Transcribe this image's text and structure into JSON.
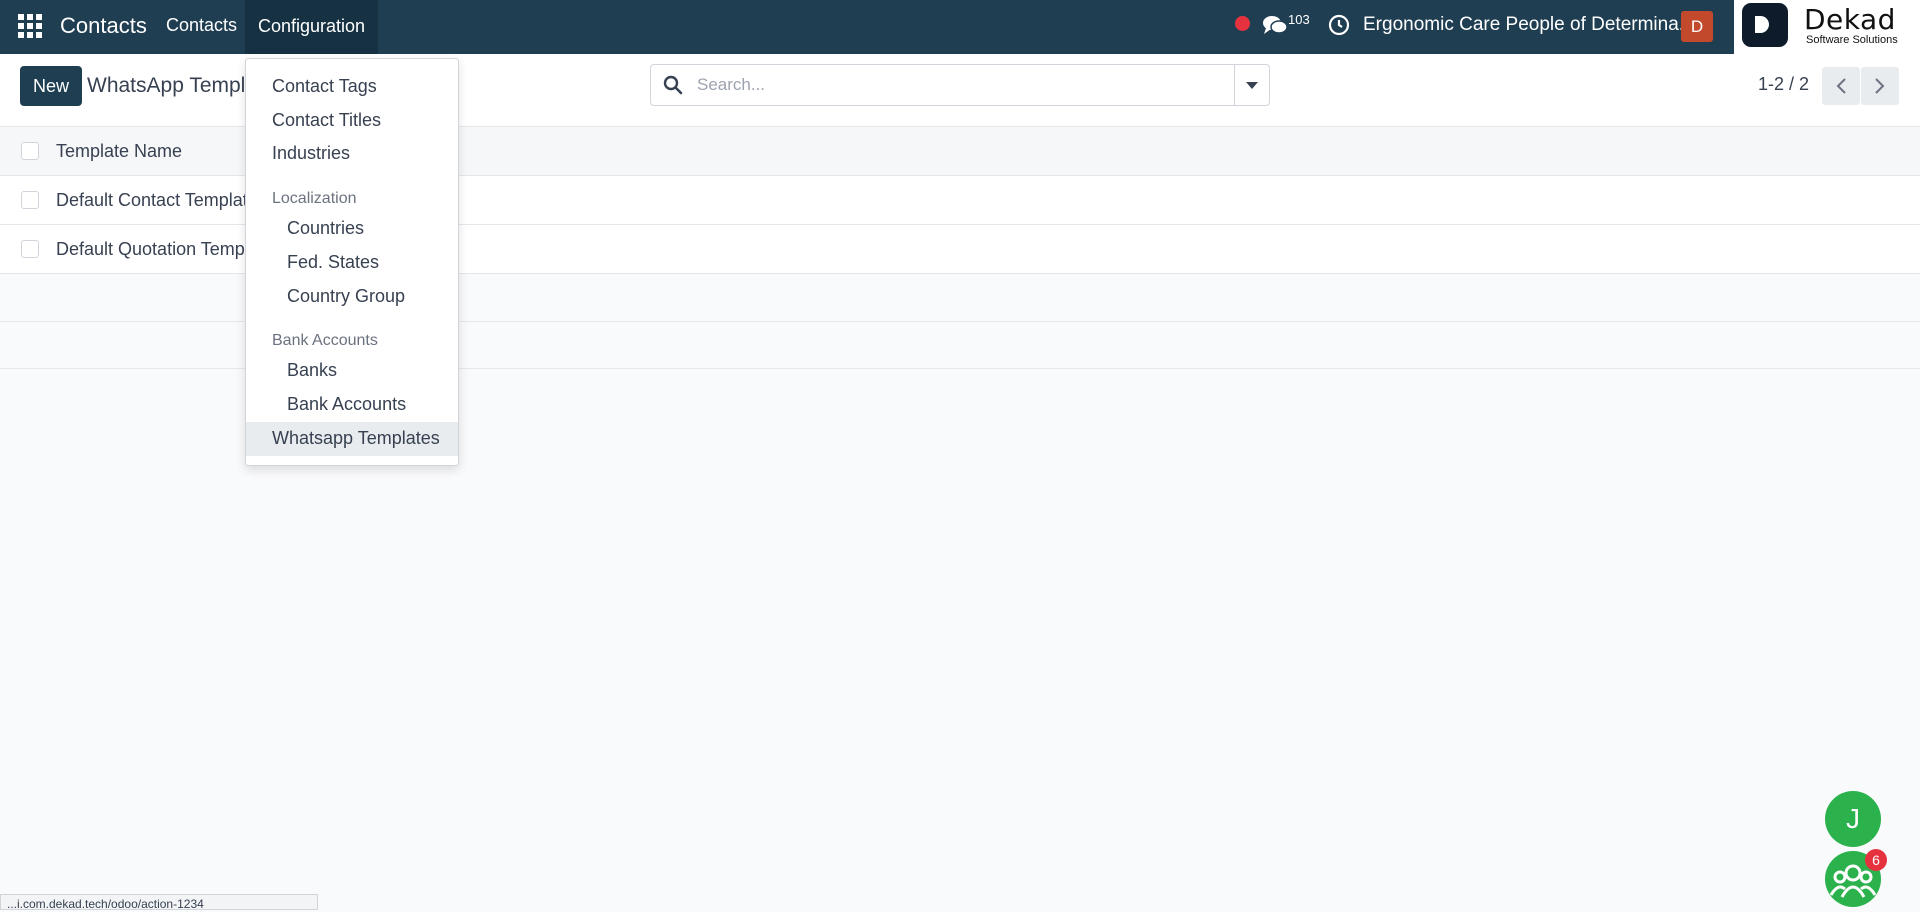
{
  "navbar": {
    "brand": "Contacts",
    "menu_contacts": "Contacts",
    "menu_configuration": "Configuration",
    "messages_count": "103",
    "company_name": "Ergonomic Care People of Determina...",
    "user_initial": "D",
    "logo_title": "Dekad",
    "logo_subtitle": "Software Solutions"
  },
  "control_panel": {
    "new_label": "New",
    "title": "WhatsApp Templ",
    "search_placeholder": "Search...",
    "pager_value": "1-2 / 2"
  },
  "list": {
    "header": "Template Name",
    "rows": [
      "Default Contact Template",
      "Default Quotation Templ"
    ]
  },
  "dropdown": {
    "contact_tags": "Contact Tags",
    "contact_titles": "Contact Titles",
    "industries": "Industries",
    "localization_header": "Localization",
    "countries": "Countries",
    "fed_states": "Fed. States",
    "country_group": "Country Group",
    "bank_accounts_header": "Bank Accounts",
    "banks": "Banks",
    "bank_accounts": "Bank Accounts",
    "whatsapp_templates": "Whatsapp Templates"
  },
  "floating": {
    "user_initial": "J",
    "group_badge": "6"
  },
  "status_url": "...i.com.dekad.tech/odoo/action-1234",
  "colors": {
    "navbar": "#1f3e52",
    "accent_green": "#2bb24c",
    "badge_red": "#e5323e",
    "avatar": "#c2492b"
  }
}
